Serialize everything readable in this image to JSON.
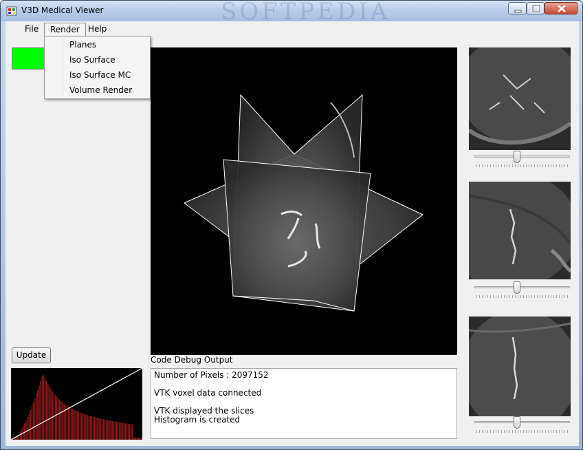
{
  "window": {
    "title": "V3D Medical Viewer",
    "watermark": "SOFTPEDIA"
  },
  "menu": {
    "items": [
      "File",
      "Render",
      "Help"
    ],
    "open_menu": "Render",
    "render_items": [
      "Planes",
      "Iso Surface",
      "Iso Surface MC",
      "Volume Render"
    ]
  },
  "controls": {
    "update_label": "Update",
    "swatch_color": "#00ff00"
  },
  "debug": {
    "label": "Code Debug Output",
    "lines": [
      "Number of Pixels : 2097152",
      "",
      "VTK voxel data connected",
      "",
      "VTK displayed the slices",
      "Histogram is created"
    ]
  },
  "slice_sliders": [
    0.44,
    0.44,
    0.44
  ],
  "colors": {
    "histogram_bar": "#8b1a1a",
    "background": "#f0f0f0"
  }
}
